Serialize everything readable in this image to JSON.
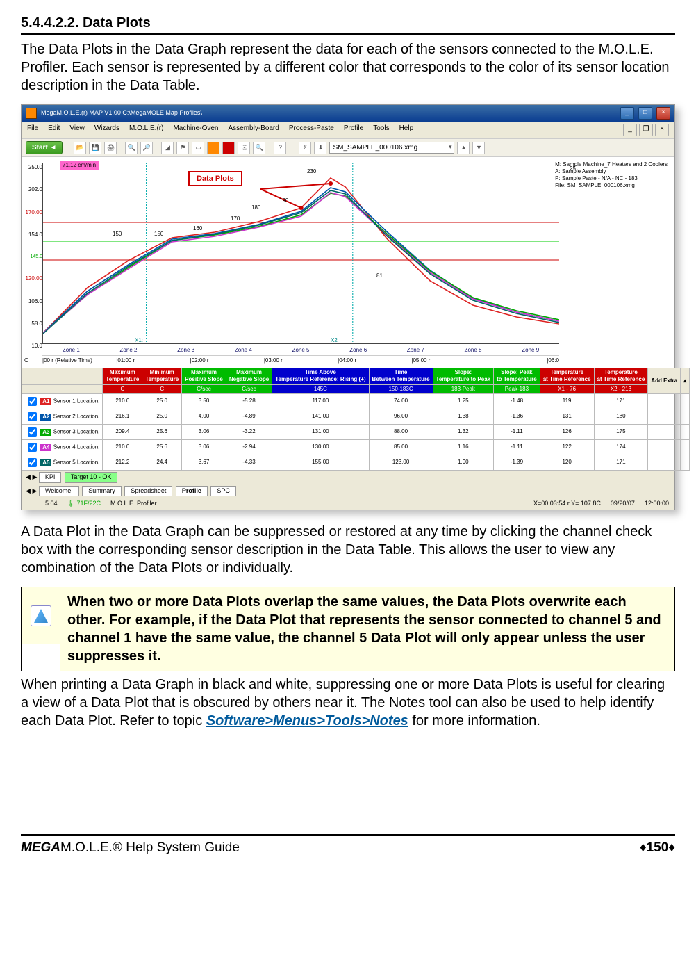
{
  "heading": "5.4.4.2.2. Data Plots",
  "para1": "The Data Plots in the Data Graph represent the data for each of the sensors connected to the M.O.L.E. Profiler. Each sensor is represented by a different color that corresponds to the color of its sensor location description in the Data Table.",
  "para2": "A Data Plot in the Data Graph can be suppressed or restored at any time by clicking the channel check box with the corresponding sensor description in the Data Table. This allows the user to view any combination of the Data Plots or individually.",
  "info_text": "When two or more Data Plots overlap the same values, the Data Plots overwrite each other. For example, if the Data Plot that represents the sensor connected to channel 5 and channel 1 have the same value, the channel 5 Data Plot will only appear unless the user suppresses it.",
  "para3a": "When printing a Data Graph in black and white, suppressing one or more Data Plots is useful for clearing a view of a Data Plot that is obscured by others near it. The Notes tool can also be used to help identify each Data Plot. Refer to topic ",
  "ref_link": "Software>Menus>Tools>Notes",
  "para3b": " for more information.",
  "footer_left_bold": "MEGA",
  "footer_left_rest": "M.O.L.E.® Help System Guide",
  "footer_right": "♦150♦",
  "app": {
    "title": "MegaM.O.L.E.(r) MAP V1.00    C:\\MegaMOLE Map Profiles\\",
    "menus": [
      "File",
      "Edit",
      "View",
      "Wizards",
      "M.O.L.E.(r)",
      "Machine-Oven",
      "Assembly-Board",
      "Process-Paste",
      "Profile",
      "Tools",
      "Help"
    ],
    "start": "Start ◄",
    "combo": "SM_SAMPLE_000106.xmg",
    "rate_badge": "71.12 cm/min",
    "callout": "Data Plots",
    "legend": [
      "M: Sample Machine_7 Heaters and 2 Coolers",
      "A: Sample Assembly",
      "P: Sample Paste - N/A - NC - 183",
      "File: SM_SAMPLE_000106.xmg"
    ],
    "y_ticks": [
      "250.0",
      "202.0",
      "170.00",
      "154.0",
      "145.0",
      "120.00",
      "106.0",
      "58.0",
      "10.0"
    ],
    "axis_unit": "C",
    "peak_label": "230",
    "peak_right_label": "25",
    "point_labels": [
      "150",
      "150",
      "160",
      "170",
      "180",
      "190",
      "81"
    ],
    "zones": [
      "Zone 1",
      "Zone 2",
      "Zone 3",
      "Zone 4",
      "Zone 5",
      "Zone 6",
      "Zone 7",
      "Zone 8",
      "Zone 9"
    ],
    "x1_label": "X1:",
    "x2_label": "X2",
    "time_axis": [
      "|00 r (Relative Time)",
      "|01:00 r",
      "|02:00 r",
      "|03:00 r",
      "|04:00 r",
      "|05:00 r",
      "|06:0"
    ],
    "table": {
      "headers": [
        {
          "cls": "hdr-red",
          "t1": "Maximum",
          "t2": "Temperature"
        },
        {
          "cls": "hdr-red",
          "t1": "Minimum",
          "t2": "Temperature"
        },
        {
          "cls": "hdr-green",
          "t1": "Maximum",
          "t2": "Positive Slope"
        },
        {
          "cls": "hdr-green",
          "t1": "Maximum",
          "t2": "Negative Slope"
        },
        {
          "cls": "hdr-blue",
          "t1": "Time Above",
          "t2": "Temperature Reference: Rising (+)"
        },
        {
          "cls": "hdr-blue",
          "t1": "Time",
          "t2": "Between Temperature"
        },
        {
          "cls": "hdr-green",
          "t1": "Slope:",
          "t2": "Temperature to Peak"
        },
        {
          "cls": "hdr-green",
          "t1": "Slope: Peak",
          "t2": "to Temperature"
        },
        {
          "cls": "hdr-red",
          "t1": "Temperature",
          "t2": "at Time Reference"
        },
        {
          "cls": "hdr-red",
          "t1": "Temperature",
          "t2": "at Time Reference"
        }
      ],
      "add_extra": "Add Extra",
      "units_row": [
        "C",
        "C",
        "C/sec",
        "C/sec",
        "145C",
        "150-183C",
        "183-Peak",
        "Peak-183",
        "X1 - 76",
        "X2 - 213"
      ],
      "rows": [
        {
          "chip_bg": "#d22",
          "chip": "A1",
          "label": "Sensor 1 Location.",
          "v": [
            "210.0",
            "25.0",
            "3.50",
            "-5.28",
            "117.00",
            "74.00",
            "1.25",
            "-1.48",
            "119",
            "171"
          ]
        },
        {
          "chip_bg": "#05a",
          "chip": "A2",
          "label": "Sensor 2 Location.",
          "v": [
            "216.1",
            "25.0",
            "4.00",
            "-4.89",
            "141.00",
            "96.00",
            "1.38",
            "-1.36",
            "131",
            "180"
          ]
        },
        {
          "chip_bg": "#0a0",
          "chip": "A3",
          "label": "Sensor 3 Location.",
          "v": [
            "209.4",
            "25.6",
            "3.06",
            "-3.22",
            "131.00",
            "88.00",
            "1.32",
            "-1.11",
            "126",
            "175"
          ]
        },
        {
          "chip_bg": "#c3c",
          "chip": "A4",
          "label": "Sensor 4 Location.",
          "v": [
            "210.0",
            "25.6",
            "3.06",
            "-2.94",
            "130.00",
            "85.00",
            "1.16",
            "-1.11",
            "122",
            "174"
          ]
        },
        {
          "chip_bg": "#066",
          "chip": "A5",
          "label": "Sensor 5 Location.",
          "v": [
            "212.2",
            "24.4",
            "3.67",
            "-4.33",
            "155.00",
            "123.00",
            "1.90",
            "-1.39",
            "120",
            "171"
          ]
        }
      ],
      "kpi_tab": "KPI",
      "target_tab": "Target 10 - OK"
    },
    "bottom_tabs": [
      "Welcome!",
      "Summary",
      "Spreadsheet",
      "Profile",
      "SPC"
    ],
    "status": {
      "left1": "5.04",
      "left2": "71F/22C",
      "left3": "M.O.L.E. Profiler",
      "coord": "X=00:03:54 r Y= 107.8C",
      "date": "09/20/07",
      "time": "12:00:00"
    }
  },
  "chart_data": {
    "type": "line",
    "title": "Data Plots",
    "xlabel": "Relative Time",
    "ylabel": "C",
    "ylim": [
      10,
      250
    ],
    "x_ticks_minutes": [
      0,
      1,
      2,
      3,
      4,
      5,
      6
    ],
    "annotations": {
      "rate": "71.12 cm/min",
      "peak": 230,
      "cooler": 25
    },
    "series": [
      {
        "name": "Sensor 1",
        "color": "#d22",
        "x": [
          0,
          0.5,
          1.0,
          1.5,
          2.0,
          2.5,
          3.0,
          3.35,
          3.5,
          4.0,
          4.5,
          5.0,
          5.5,
          6.0
        ],
        "y": [
          25,
          80,
          120,
          150,
          160,
          175,
          195,
          230,
          220,
          150,
          95,
          60,
          40,
          30
        ]
      },
      {
        "name": "Sensor 2",
        "color": "#05a",
        "x": [
          0,
          0.5,
          1.0,
          1.5,
          2.0,
          2.5,
          3.0,
          3.35,
          3.5,
          4.0,
          4.5,
          5.0,
          5.5,
          6.0
        ],
        "y": [
          25,
          75,
          115,
          148,
          158,
          172,
          190,
          216,
          212,
          160,
          110,
          70,
          45,
          32
        ]
      },
      {
        "name": "Sensor 3",
        "color": "#0a0",
        "x": [
          0,
          0.5,
          1.0,
          1.5,
          2.0,
          2.5,
          3.0,
          3.35,
          3.5,
          4.0,
          4.5,
          5.0,
          5.5,
          6.0
        ],
        "y": [
          25,
          70,
          110,
          145,
          156,
          170,
          186,
          209,
          205,
          158,
          112,
          72,
          48,
          34
        ]
      },
      {
        "name": "Sensor 4",
        "color": "#c3c",
        "x": [
          0,
          0.5,
          1.0,
          1.5,
          2.0,
          2.5,
          3.0,
          3.35,
          3.5,
          4.0,
          4.5,
          5.0,
          5.5,
          6.0
        ],
        "y": [
          25,
          70,
          108,
          144,
          155,
          168,
          184,
          210,
          204,
          156,
          110,
          70,
          46,
          33
        ]
      },
      {
        "name": "Sensor 5",
        "color": "#066",
        "x": [
          0,
          0.5,
          1.0,
          1.5,
          2.0,
          2.5,
          3.0,
          3.35,
          3.5,
          4.0,
          4.5,
          5.0,
          5.5,
          6.0
        ],
        "y": [
          24,
          72,
          112,
          146,
          157,
          171,
          189,
          212,
          208,
          155,
          108,
          68,
          44,
          31
        ]
      }
    ],
    "zone_markers_x": [
      "Zone 1",
      "Zone 2",
      "Zone 3",
      "Zone 4",
      "Zone 5",
      "Zone 6",
      "Zone 7",
      "Zone 8",
      "Zone 9"
    ],
    "x_markers": {
      "X1": 1.2,
      "X2": 3.6
    }
  }
}
